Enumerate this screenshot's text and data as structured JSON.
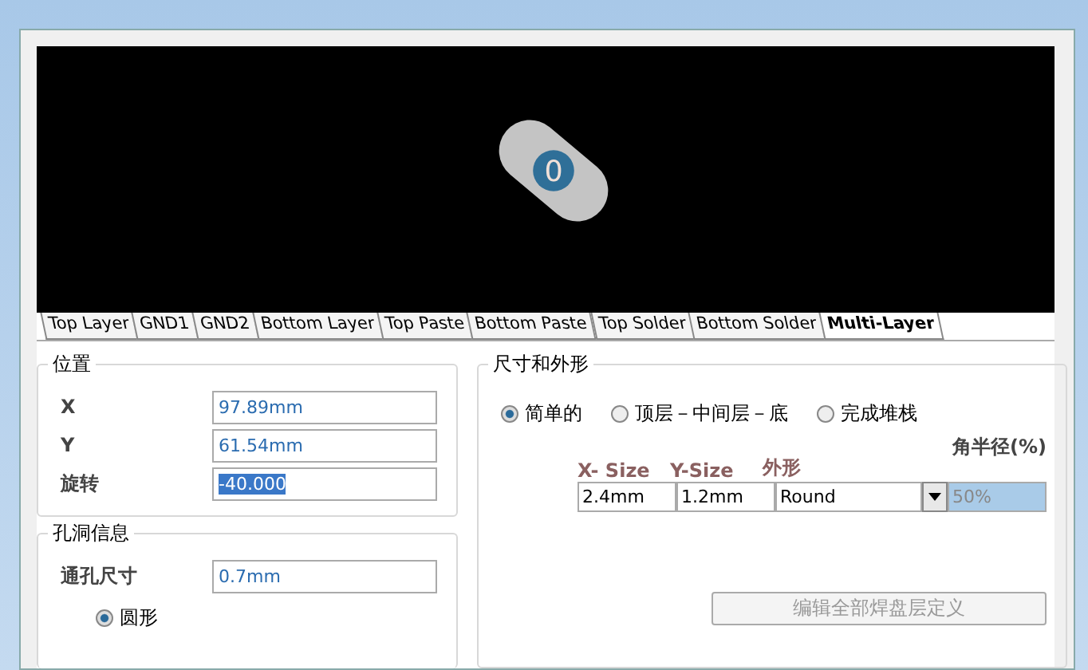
{
  "preview": {
    "pad_label": "0"
  },
  "layer_tabs": [
    {
      "label": "Top Layer",
      "selected": false
    },
    {
      "label": "GND1",
      "selected": false
    },
    {
      "label": "GND2",
      "selected": false
    },
    {
      "label": "Bottom Layer",
      "selected": false
    },
    {
      "label": "Top Paste",
      "selected": false
    },
    {
      "label": "Bottom Paste",
      "selected": false
    },
    {
      "label": "Top Solder",
      "selected": false
    },
    {
      "label": "Bottom Solder",
      "selected": false
    },
    {
      "label": "Multi-Layer",
      "selected": true
    }
  ],
  "position": {
    "title": "位置",
    "fields": [
      {
        "label": "X",
        "value": "97.89mm",
        "highlighted": false
      },
      {
        "label": "Y",
        "value": "61.54mm",
        "highlighted": false
      },
      {
        "label": "旋转",
        "value": "-40.000",
        "highlighted": true
      }
    ]
  },
  "hole": {
    "title": "孔洞信息",
    "size_label": "通孔尺寸",
    "size_value": "0.7mm",
    "shapes": [
      {
        "label": "圆形",
        "selected": true
      }
    ]
  },
  "size_shape": {
    "title": "尺寸和外形",
    "modes": [
      {
        "label": "简单的",
        "selected": true
      },
      {
        "label": "顶层－中间层－底",
        "selected": false
      },
      {
        "label": "完成堆栈",
        "selected": false
      }
    ],
    "corner_label": "角半径(%)",
    "columns": [
      "X- Size",
      "Y-Size",
      "外形"
    ],
    "row": {
      "x_size": "2.4mm",
      "y_size": "1.2mm",
      "shape": "Round",
      "corner": "50%"
    },
    "edit_button": {
      "label": "编辑全部焊盘层定义",
      "disabled": true
    }
  }
}
